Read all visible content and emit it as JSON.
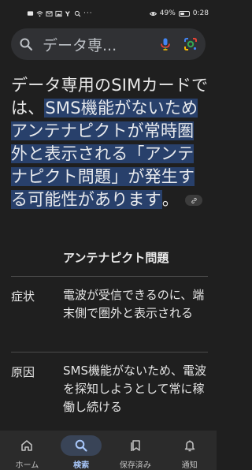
{
  "status_bar": {
    "battery_percent": "49%",
    "time": "0:28"
  },
  "search": {
    "query": "データ専..."
  },
  "snippet": {
    "before": "データ専用のSIMカードでは、",
    "highlight": "SMS機能がないためアンテナピクトが常時圏外と表示される「アンテナピクト問題」が発生する可能性があります",
    "after": "。"
  },
  "table": {
    "header": "アンテナピクト問題",
    "rows": [
      {
        "label": "症状",
        "value": "電波が受信できるのに、端末側で圏外と表示される"
      },
      {
        "label": "原因",
        "value": "SMS機能がないため、電波を探知しようとして常に稼働し続ける"
      }
    ]
  },
  "bottom_nav": {
    "items": [
      {
        "label": "ホーム",
        "icon": "home-icon"
      },
      {
        "label": "検索",
        "icon": "search-icon",
        "active": true
      },
      {
        "label": "保存済み",
        "icon": "saved-icon"
      },
      {
        "label": "通知",
        "icon": "bell-icon"
      }
    ]
  },
  "colors": {
    "background": "#1f1f1f",
    "highlight": "#28406b",
    "active_nav": "#a8c7fa"
  }
}
